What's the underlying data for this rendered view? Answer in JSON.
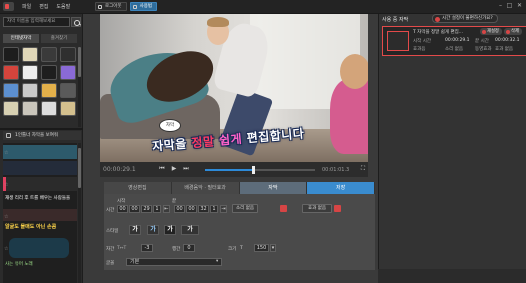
{
  "menu": {
    "file": "파일",
    "edit": "편집",
    "help": "도움말"
  },
  "modes": {
    "shortcut": "로그아웃",
    "user": "사용법"
  },
  "left": {
    "search_placeholder": "자막 이름을 입력해보세요",
    "tabs": [
      "인테넷자막",
      "즐겨찾기"
    ],
    "section_title": "1인틀너 자막을 보여줘",
    "stack_texts": [
      "재생 리리 후 트를 배우는 사람들을",
      "알굴도 몰매도 아닌 손콤",
      "사는 유머 노래"
    ]
  },
  "video": {
    "bubble": "자막",
    "caption_parts": {
      "a": "자막을 ",
      "b": "정말 ",
      "c": "쉽게 ",
      "d": "편집합니다"
    }
  },
  "transport": {
    "current": "00:00:29.1",
    "total": "00:01:01.3"
  },
  "edit_tabs": [
    "영상편집",
    "배경음악 · 필터효과",
    "자막",
    "저장"
  ],
  "edit": {
    "time_label": "시간",
    "start_label": "시작",
    "end_label": "끝",
    "start": [
      "00",
      "00",
      "29",
      "1"
    ],
    "end": [
      "00",
      "00",
      "32",
      "1"
    ],
    "sound_label": "소리 없음",
    "effect_label": "효과 없음",
    "style_label": "스타일",
    "style_glyphs": [
      "가",
      "가",
      "가",
      "가"
    ],
    "spacing_label": "자간",
    "spacing_value": "-3",
    "line_label": "행간",
    "line_value": "0",
    "size_label": "크기",
    "size_value": "150",
    "preset_label": "글꼴",
    "preset_value": "기본"
  },
  "right": {
    "title": "사용 중 자막",
    "tip": "시간 설정이 불편하신가요?",
    "row_name": "T 자막을 정말 쉽게 편집...",
    "row_delete": "삭제",
    "start_time_label": "시작 시간",
    "start_time": "00:00:29.1",
    "end_time_label": "끝 시간",
    "end_time": "00:00:32.1",
    "sound_label": "효과음",
    "sound_value": "소리 없음",
    "effect_label": "동영효과",
    "effect_value": "효과 없음",
    "edit_btn": "재설정"
  },
  "colors": {
    "accent": "#3a8ccf",
    "alert": "#d64545"
  }
}
